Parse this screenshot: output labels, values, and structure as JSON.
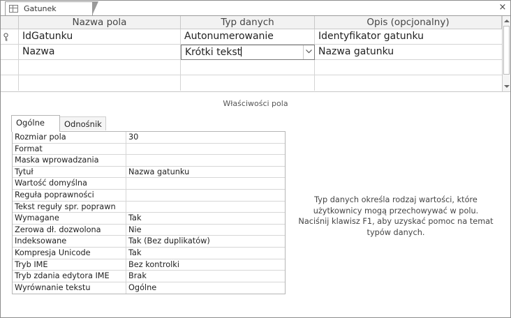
{
  "tab": {
    "title": "Gatunek",
    "icon": "table-icon",
    "close": "×"
  },
  "grid": {
    "headers": [
      "Nazwa pola",
      "Typ danych",
      "Opis (opcjonalny)"
    ],
    "rows": [
      {
        "name": "IdGatunku",
        "type": "Autonumerowanie",
        "desc": "Identyfikator gatunku",
        "primary_key": true
      },
      {
        "name": "Nazwa",
        "type": "Krótki tekst",
        "desc": "Nazwa gatunku",
        "active": true
      }
    ]
  },
  "properties": {
    "title": "Właściwości pola",
    "tabs": [
      "Ogólne",
      "Odnośnik"
    ],
    "active_tab": "Ogólne",
    "rows": [
      {
        "name": "Rozmiar pola",
        "value": "30"
      },
      {
        "name": "Format",
        "value": ""
      },
      {
        "name": "Maska wprowadzania",
        "value": ""
      },
      {
        "name": "Tytuł",
        "value": "Nazwa gatunku"
      },
      {
        "name": "Wartość domyślna",
        "value": ""
      },
      {
        "name": "Reguła poprawności",
        "value": ""
      },
      {
        "name": "Tekst reguły spr. poprawn",
        "value": ""
      },
      {
        "name": "Wymagane",
        "value": "Tak"
      },
      {
        "name": "Zerowa dł. dozwolona",
        "value": "Nie"
      },
      {
        "name": "Indeksowane",
        "value": "Tak (Bez duplikatów)"
      },
      {
        "name": "Kompresja Unicode",
        "value": "Tak"
      },
      {
        "name": "Tryb IME",
        "value": "Bez kontrolki"
      },
      {
        "name": "Tryb zdania edytora IME",
        "value": "Brak"
      },
      {
        "name": "Wyrównanie tekstu",
        "value": "Ogólne"
      }
    ],
    "help_text": "Typ danych określa rodzaj wartości, które użytkownicy mogą przechowywać w polu. Naciśnij klawisz F1, aby uzyskać pomoc na temat typów danych."
  }
}
